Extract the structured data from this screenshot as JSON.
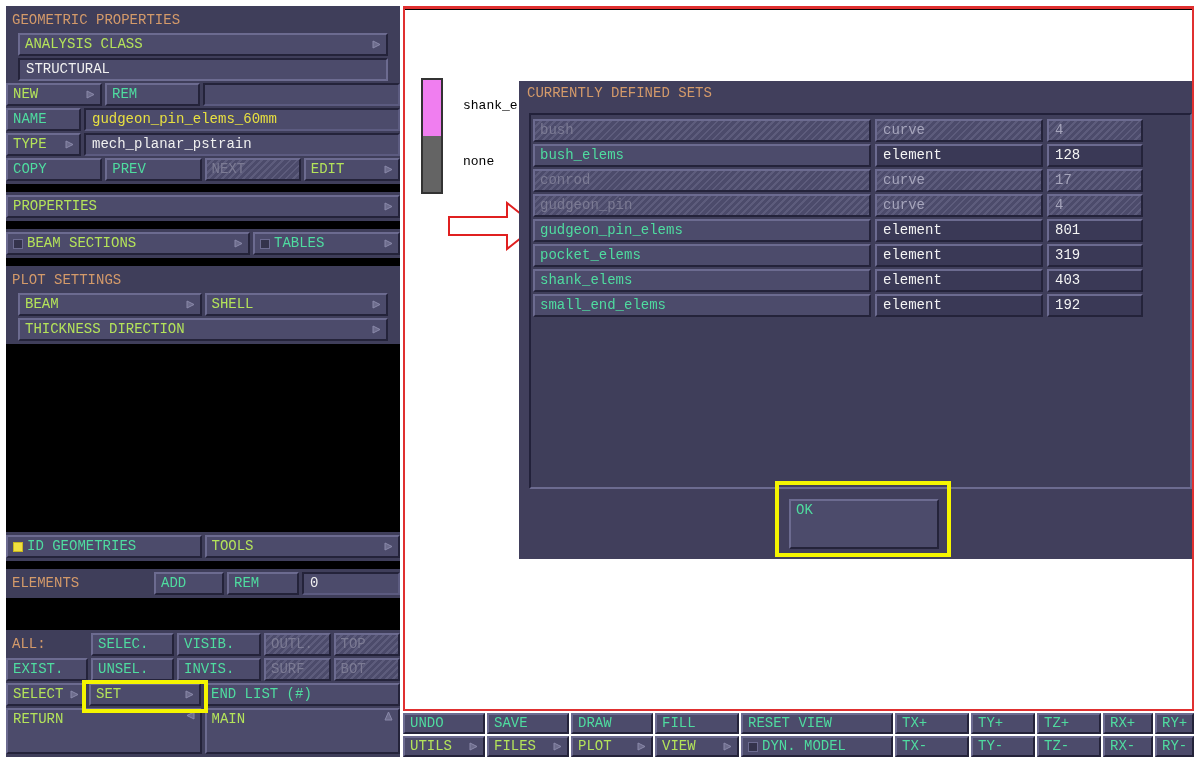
{
  "left_panel": {
    "sections": [
      {
        "kind": "block",
        "rows": [
          {
            "kind": "heading",
            "cells": [
              {
                "kind": "label",
                "text": "GEOMETRIC PROPERTIES"
              }
            ]
          },
          {
            "kind": "inset",
            "cells": [
              {
                "kind": "menu_button",
                "label": "ANALYSIS CLASS",
                "color": "#b4e35a",
                "disabled": false
              }
            ]
          },
          {
            "kind": "inset",
            "cells": [
              {
                "kind": "display",
                "value": "STRUCTURAL"
              }
            ]
          },
          {
            "kind": "split_3",
            "cells": [
              {
                "kind": "menu_button",
                "label": "NEW",
                "color": "#b4e35a",
                "disabled": false
              },
              {
                "kind": "button",
                "label": "REM",
                "color": "#4fdca0",
                "disabled": false
              },
              {
                "kind": "blank"
              }
            ]
          },
          {
            "kind": "field",
            "cells": [
              {
                "kind": "button",
                "label": "NAME",
                "color": "#4fdca0",
                "disabled": false
              },
              {
                "kind": "field",
                "value": "gudgeon_pin_elems_60mm",
                "color": "#e8e040"
              }
            ]
          },
          {
            "kind": "field",
            "cells": [
              {
                "kind": "menu_button",
                "label": "TYPE",
                "color": "#b4e35a",
                "disabled": false
              },
              {
                "kind": "field",
                "value": "mech_planar_pstrain",
                "color": "#f0f0f0"
              }
            ]
          },
          {
            "kind": "quad",
            "cells": [
              {
                "kind": "button",
                "label": "COPY",
                "color": "#4fdca0",
                "disabled": false
              },
              {
                "kind": "button",
                "label": "PREV",
                "color": "#4fdca0",
                "disabled": false
              },
              {
                "kind": "button",
                "label": "NEXT",
                "disabled": true
              },
              {
                "kind": "menu_button",
                "label": "EDIT",
                "color": "#b4e35a",
                "disabled": false
              }
            ]
          }
        ]
      },
      {
        "kind": "block",
        "rows": [
          {
            "kind": "full",
            "cells": [
              {
                "kind": "menu_button",
                "label": "PROPERTIES",
                "color": "#b4e35a",
                "disabled": false
              }
            ]
          }
        ]
      },
      {
        "kind": "block",
        "rows": [
          {
            "kind": "wide_pair",
            "cells": [
              {
                "kind": "menu_check_button",
                "label": "BEAM SECTIONS",
                "color": "#b4e35a",
                "checked": false,
                "disabled": false
              },
              {
                "kind": "menu_check_button",
                "label": "TABLES",
                "color": "#4fdca0",
                "checked": false,
                "disabled": false
              }
            ]
          }
        ]
      },
      {
        "kind": "block",
        "rows": [
          {
            "kind": "heading",
            "cells": [
              {
                "kind": "label",
                "text": "PLOT SETTINGS"
              }
            ]
          },
          {
            "kind": "inset_pair",
            "cells": [
              {
                "kind": "menu_button",
                "label": "BEAM",
                "color": "#b4e35a",
                "disabled": false
              },
              {
                "kind": "menu_button",
                "label": "SHELL",
                "color": "#b4e35a",
                "disabled": false
              }
            ]
          },
          {
            "kind": "inset",
            "cells": [
              {
                "kind": "menu_button",
                "label": "THICKNESS DIRECTION",
                "color": "#b4e35a",
                "disabled": false
              }
            ]
          }
        ]
      },
      {
        "kind": "void"
      },
      {
        "kind": "block",
        "rows": [
          {
            "kind": "half",
            "cells": [
              {
                "kind": "check_button",
                "label": "ID GEOMETRIES",
                "color": "#4fdca0",
                "checked": true,
                "disabled": false
              },
              {
                "kind": "menu_button",
                "label": "TOOLS",
                "color": "#b4e35a",
                "disabled": false
              }
            ]
          }
        ]
      },
      {
        "kind": "block",
        "rows": [
          {
            "kind": "elements",
            "cells": [
              {
                "kind": "label",
                "text": "ELEMENTS"
              },
              {
                "kind": "button",
                "label": "ADD",
                "color": "#4fdca0",
                "disabled": false
              },
              {
                "kind": "button",
                "label": "REM",
                "color": "#4fdca0",
                "disabled": false
              },
              {
                "kind": "field",
                "value": "0",
                "color": "#f0f0f0"
              }
            ]
          }
        ]
      },
      {
        "kind": "void"
      },
      {
        "kind": "block",
        "rows": [
          {
            "kind": "five",
            "cells": [
              {
                "kind": "label",
                "text": "ALL:"
              },
              {
                "kind": "button",
                "label": "SELEC.",
                "color": "#4fdca0",
                "disabled": false
              },
              {
                "kind": "button",
                "label": "VISIB.",
                "color": "#4fdca0",
                "disabled": false
              },
              {
                "kind": "button",
                "label": "OUTL.",
                "disabled": true
              },
              {
                "kind": "button",
                "label": "TOP",
                "disabled": true
              }
            ]
          },
          {
            "kind": "five",
            "cells": [
              {
                "kind": "button",
                "label": "EXIST.",
                "color": "#4fdca0",
                "disabled": false
              },
              {
                "kind": "button",
                "label": "UNSEL.",
                "color": "#4fdca0",
                "disabled": false
              },
              {
                "kind": "button",
                "label": "INVIS.",
                "color": "#4fdca0",
                "disabled": false
              },
              {
                "kind": "button",
                "label": "SURF",
                "disabled": true
              },
              {
                "kind": "button",
                "label": "BOT",
                "disabled": true
              }
            ]
          },
          {
            "kind": "select",
            "cells": [
              {
                "kind": "menu_button",
                "label": "SELECT",
                "color": "#b4e35a",
                "disabled": false
              },
              {
                "kind": "menu_button",
                "label": "SET",
                "color": "#b4e35a",
                "disabled": false
              },
              {
                "kind": "button",
                "label": "END LIST (#)",
                "color": "#4fdca0",
                "disabled": false
              }
            ]
          },
          {
            "kind": "tall_half",
            "cells": [
              {
                "kind": "back_button",
                "label": "RETURN",
                "color": "#b4e35a",
                "disabled": false
              },
              {
                "kind": "up_button",
                "label": "MAIN",
                "color": "#b4e35a",
                "disabled": false
              }
            ]
          }
        ]
      }
    ]
  },
  "legend": [
    {
      "label": "shank_e",
      "color": "#f07ef0"
    },
    {
      "label": "none",
      "color": "#646464"
    }
  ],
  "dialog": {
    "title": "CURRENTLY DEFINED SETS",
    "rows": [
      {
        "name": "bush",
        "type": "curve",
        "count": "4",
        "disabled": true
      },
      {
        "name": "bush_elems",
        "type": "element",
        "count": "128",
        "disabled": false
      },
      {
        "name": "conrod",
        "type": "curve",
        "count": "17",
        "disabled": true
      },
      {
        "name": "gudgeon_pin",
        "type": "curve",
        "count": "4",
        "disabled": true
      },
      {
        "name": "gudgeon_pin_elems",
        "type": "element",
        "count": "801",
        "disabled": false
      },
      {
        "name": "pocket_elems",
        "type": "element",
        "count": "319",
        "disabled": false
      },
      {
        "name": "shank_elems",
        "type": "element",
        "count": "403",
        "disabled": false
      },
      {
        "name": "small_end_elems",
        "type": "element",
        "count": "192",
        "disabled": false
      }
    ],
    "ok_button": {
      "label": "OK"
    }
  },
  "toolbar": {
    "columns": [
      {
        "top": {
          "kind": "button",
          "label": "UNDO",
          "color": "#4fdca0",
          "disabled": false
        },
        "bottom": {
          "kind": "menu_button",
          "label": "UTILS",
          "color": "#b4e35a",
          "disabled": false
        }
      },
      {
        "top": {
          "kind": "button",
          "label": "SAVE",
          "color": "#4fdca0",
          "disabled": false
        },
        "bottom": {
          "kind": "menu_button",
          "label": "FILES",
          "color": "#b4e35a",
          "disabled": false
        }
      },
      {
        "top": {
          "kind": "button",
          "label": "DRAW",
          "color": "#4fdca0",
          "disabled": false
        },
        "bottom": {
          "kind": "menu_button",
          "label": "PLOT",
          "color": "#b4e35a",
          "disabled": false
        }
      },
      {
        "top": {
          "kind": "button",
          "label": "FILL",
          "color": "#4fdca0",
          "disabled": false
        },
        "bottom": {
          "kind": "menu_button",
          "label": "VIEW",
          "color": "#b4e35a",
          "disabled": false
        }
      },
      {
        "top": {
          "kind": "button",
          "label": "RESET VIEW",
          "color": "#4fdca0",
          "disabled": false
        },
        "bottom": {
          "kind": "check_button",
          "label": "DYN. MODEL",
          "color": "#4fdca0",
          "checked": false,
          "disabled": false
        }
      },
      {
        "top": {
          "kind": "button",
          "label": "TX+",
          "color": "#4fdca0",
          "disabled": false
        },
        "bottom": {
          "kind": "button",
          "label": "TX-",
          "color": "#4fdca0",
          "disabled": false
        }
      },
      {
        "top": {
          "kind": "button",
          "label": "TY+",
          "color": "#4fdca0",
          "disabled": false
        },
        "bottom": {
          "kind": "button",
          "label": "TY-",
          "color": "#4fdca0",
          "disabled": false
        }
      },
      {
        "top": {
          "kind": "button",
          "label": "TZ+",
          "color": "#4fdca0",
          "disabled": false
        },
        "bottom": {
          "kind": "button",
          "label": "TZ-",
          "color": "#4fdca0",
          "disabled": false
        }
      },
      {
        "top": {
          "kind": "button",
          "label": "RX+",
          "color": "#4fdca0",
          "disabled": false
        },
        "bottom": {
          "kind": "button",
          "label": "RX-",
          "color": "#4fdca0",
          "disabled": false
        }
      },
      {
        "top": {
          "kind": "button",
          "label": "RY+",
          "color": "#4fdca0",
          "disabled": false
        },
        "bottom": {
          "kind": "button",
          "label": "RY-",
          "color": "#4fdca0",
          "disabled": false
        }
      }
    ]
  }
}
